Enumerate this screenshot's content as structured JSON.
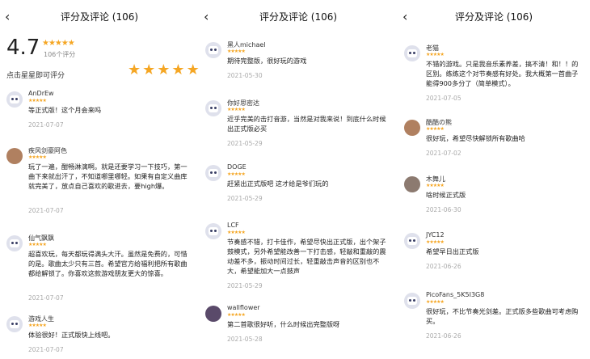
{
  "screen_title": "评分及评论 (106)",
  "summary": {
    "score": "4.7",
    "stars": "★★★★★",
    "count": "106个评分",
    "tap_label": "点击星星即可评分"
  },
  "star_glyph": "★",
  "star_color": "#f5a623",
  "panels": [
    {
      "reviews": [
        {
          "user": "AnDrEw",
          "avatar": "robot",
          "stars": "★★★★★",
          "text": "等正式版！这个月会来吗",
          "date": "2021-07-07"
        },
        {
          "user": "疾风剑豪阿色",
          "avatar": "photo",
          "stars": "★★★★★",
          "text": "玩了一遍，酣畅淋漓啊。就是还要学习一下技巧，第一曲下来就出汗了，不知道哪里哪轻。如果有自定义曲库就完美了，放点自己喜欢的歌进去，要high爆。",
          "date": "2021-07-07"
        },
        {
          "user": "仙气飘飘",
          "avatar": "robot",
          "stars": "★★★★★",
          "text": "超喜欢玩，每天都玩得满头大汗。虽然是免费的，可惜的是。歌曲太少只有三首。希望官方给福利把所有歌曲都给解锁了。你喜欢这款游戏朋友更大的惊喜。",
          "date": "2021-07-07"
        },
        {
          "user": "游戏人生",
          "avatar": "robot",
          "stars": "★★★★★",
          "text": "体验很好！正式版快上线吧。",
          "date": "2021-07-07"
        }
      ]
    },
    {
      "reviews": [
        {
          "user": "黑人michael",
          "avatar": "robot",
          "stars": "★★★★★",
          "text": "期待完整版，很好玩的游戏",
          "date": "2021-05-30"
        },
        {
          "user": "你好思密达",
          "avatar": "robot",
          "stars": "★★★★★",
          "text": "近乎完美的击打音游，当然是对我来说！到底什么时候出正式版必买",
          "date": "2021-05-29"
        },
        {
          "user": "DOGE",
          "avatar": "robot",
          "stars": "★★★★★",
          "text": "赶紧出正式版吧 这才给是爷们玩的",
          "date": "2021-05-29"
        },
        {
          "user": "LCF",
          "avatar": "robot",
          "stars": "★★★★★",
          "text": "节奏感不错，打卡佳作，希望尽快出正式版，出个架子鼓模式，另外希望能改善一下打击感，轻敲和重敲的震动差不多，振动时间过长，轻重敲击声音的区别也不大，希望能加大一点鼓声",
          "date": "2021-05-29"
        },
        {
          "user": "wallflower",
          "avatar": "photo3",
          "stars": "★★★★★",
          "text": "第二首歌很好听，什么时候出完整版呀",
          "date": "2021-05-28"
        }
      ]
    },
    {
      "reviews": [
        {
          "user": "老猫",
          "avatar": "robot",
          "stars": "★★★★★",
          "text": "不错的游戏。只是我音乐素养差，搞不清！和！！的区别。练练这个对节奏感有好处。我大概第一首曲子能得900多分了（简单模式）。",
          "date": "2021-07-05"
        },
        {
          "user": "酷酷の熊",
          "avatar": "photo",
          "stars": "★★★★★",
          "text": "很好玩，希望尽快解锁所有歌曲哈",
          "date": "2021-07-02"
        },
        {
          "user": "木舞儿",
          "avatar": "photo2",
          "stars": "★★★★★",
          "text": "啥时候正式版",
          "date": "2021-06-30"
        },
        {
          "user": "JYC12",
          "avatar": "robot",
          "stars": "★★★★★",
          "text": "希望早日出正式版",
          "date": "2021-06-26"
        },
        {
          "user": "PicoFans_5K5I3G8",
          "avatar": "robot",
          "stars": "★★★★★",
          "text": "很好玩，不比节奏光剑差。正式版多些歌曲可考虑购买。",
          "date": "2021-06-26"
        }
      ]
    }
  ]
}
